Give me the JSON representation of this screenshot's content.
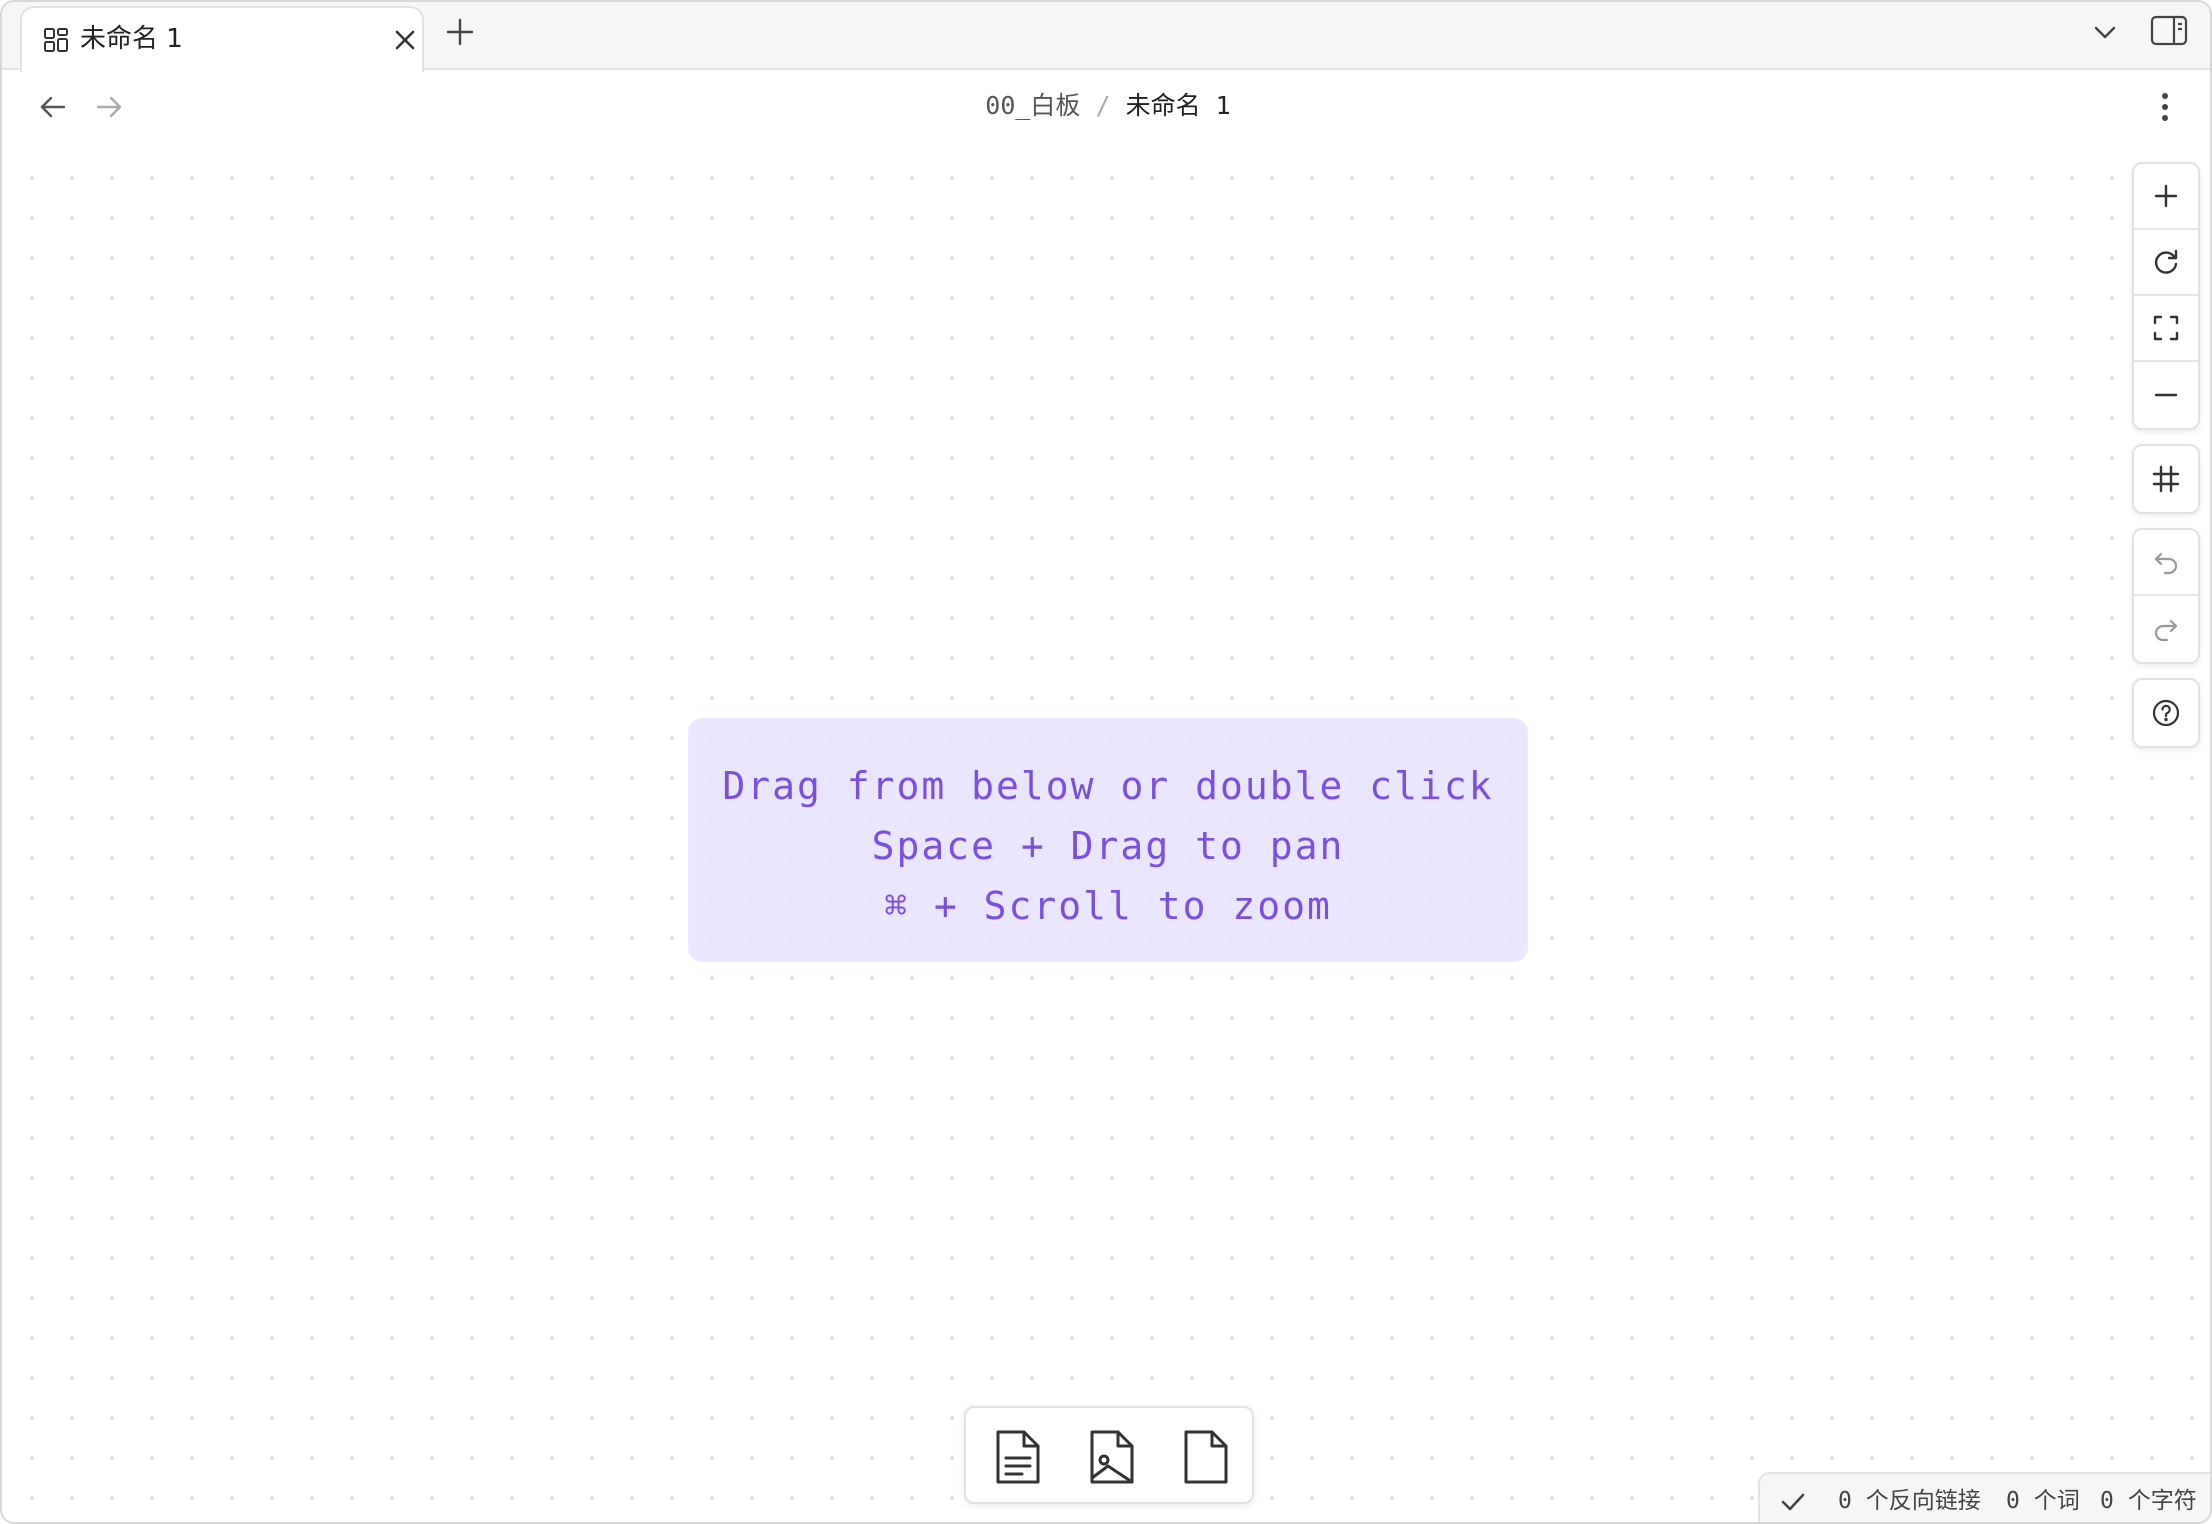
{
  "tabs": [
    {
      "title": "未命名 1",
      "icon": "canvas-grid-icon",
      "active": true
    }
  ],
  "header": {
    "breadcrumb_folder": "00_白板",
    "breadcrumb_separator": "/",
    "breadcrumb_file": "未命名 1"
  },
  "canvas": {
    "hint_lines": [
      "Drag from below or double click",
      "Space + Drag to pan",
      "⌘ + Scroll to zoom"
    ],
    "accent_color": "#7b4fe0"
  },
  "controls": {
    "zoom": [
      "zoom-in-icon",
      "reset-icon",
      "fit-screen-icon",
      "zoom-out-icon"
    ],
    "grid": [
      "grid-snap-icon"
    ],
    "history": [
      "undo-icon",
      "redo-icon"
    ],
    "help": [
      "help-icon"
    ]
  },
  "card_tray": [
    "note-card-icon",
    "media-card-icon",
    "blank-card-icon"
  ],
  "status_bar": {
    "backlinks": "0 个反向链接",
    "words": "0 个词",
    "chars": "0 个字符"
  }
}
